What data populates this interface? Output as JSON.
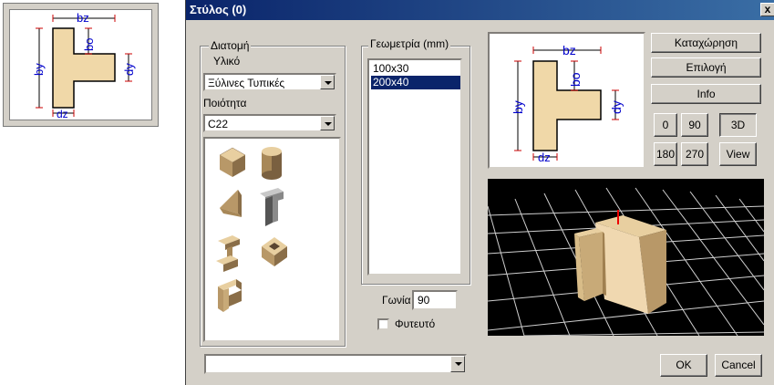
{
  "thumbnail": {
    "dims": {
      "bz": "bz",
      "bo": "bo",
      "by": "by",
      "dy": "dy",
      "dz": "dz"
    }
  },
  "dialog": {
    "title": "Στύλος (0)",
    "close_label": "x"
  },
  "section": {
    "group_label": "Διατομή",
    "material_label": "Υλικό",
    "material_value": "Ξύλινες Τυπικές",
    "quality_label": "Ποιότητα",
    "quality_value": "C22"
  },
  "shapes": [
    "box-shape",
    "cylinder-shape",
    "triangle-shape",
    "t-shape",
    "i-shape",
    "hollow-box-shape",
    "l-shape"
  ],
  "geometry": {
    "group_label": "Γεωμετρία (mm)",
    "items": [
      "100x30",
      "200x40"
    ],
    "selected_index": 1
  },
  "angle": {
    "label": "Γωνία",
    "value": "90"
  },
  "planted": {
    "label": "Φυτευτό",
    "checked": false
  },
  "buttons": {
    "register": "Καταχώρηση",
    "select": "Επιλογή",
    "info": "Info",
    "ok": "OK",
    "cancel": "Cancel"
  },
  "view_buttons": [
    "0",
    "90",
    "3D",
    "180",
    "270",
    "View"
  ],
  "active_view": "3D",
  "preview": {
    "dims": {
      "bz": "bz",
      "bo": "bo",
      "by": "by",
      "dy": "dy",
      "dz": "dz"
    }
  },
  "bottom_combo_value": "",
  "colors": {
    "wood": "#f0d8a8",
    "selection": "#0a246a",
    "dim": "#0000cc",
    "marker": "#cc0000"
  }
}
